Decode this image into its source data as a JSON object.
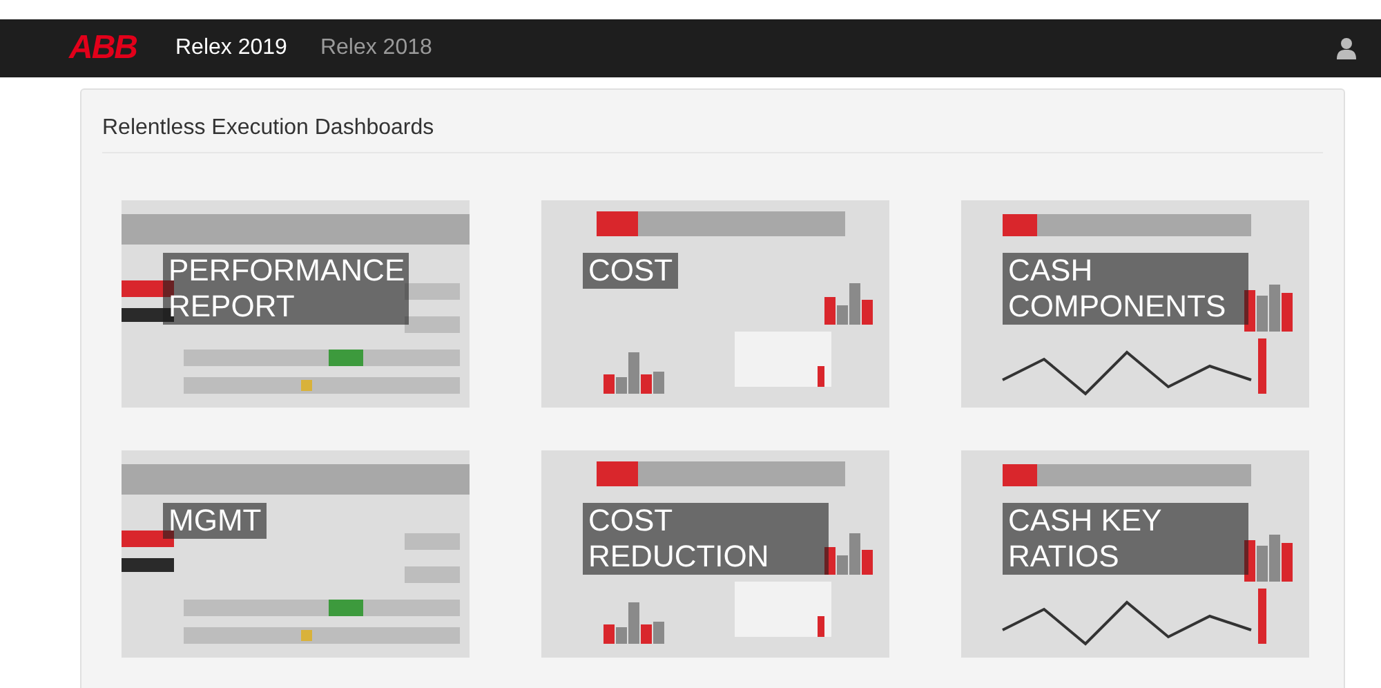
{
  "navbar": {
    "logo": "ABB",
    "tabs": [
      {
        "label": "Relex 2019",
        "selected": true
      },
      {
        "label": "Relex 2018",
        "selected": false
      }
    ]
  },
  "panel": {
    "title": "Relentless Execution Dashboards",
    "dashboards": [
      {
        "title": "PERFORMANCE REPORT",
        "kind": "picture"
      },
      {
        "title": "COST",
        "kind": "picture"
      },
      {
        "title": "CASH COMPONENTS",
        "kind": "picture"
      },
      {
        "title": "MGMT",
        "kind": "picture"
      },
      {
        "title": "COST REDUCTION",
        "kind": "picture"
      },
      {
        "title": "CASH KEY RATIOS",
        "kind": "picture"
      }
    ]
  }
}
